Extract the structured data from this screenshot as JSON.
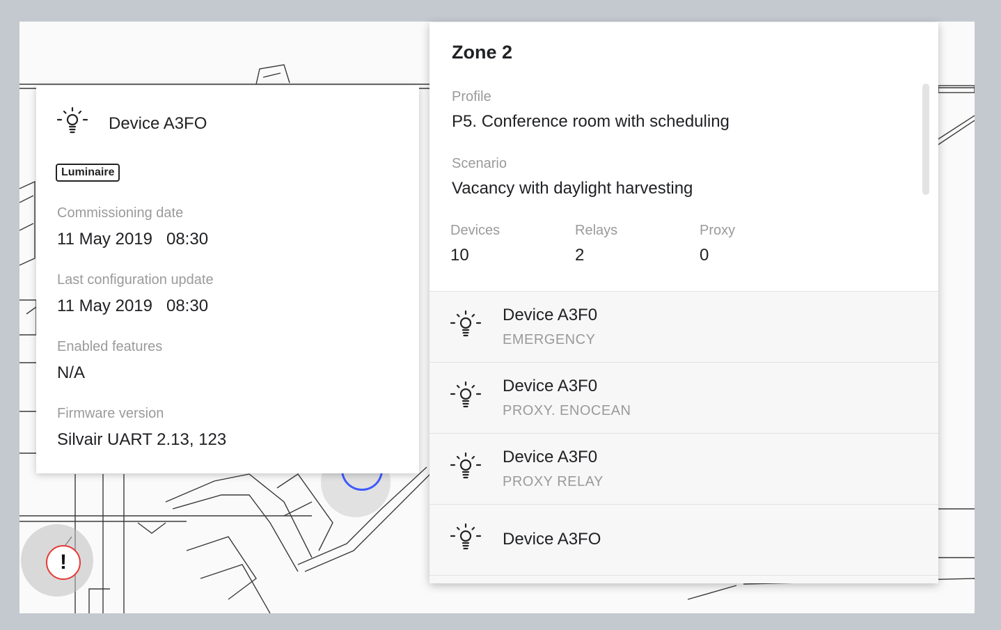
{
  "device_card": {
    "title": "Device A3FO",
    "icon": "lightbulb-icon",
    "tag": "Luminaire",
    "commissioning_label": "Commissioning date",
    "commissioning_date": "11 May 2019",
    "commissioning_time": "08:30",
    "last_update_label": "Last configuration update",
    "last_update_date": "11 May 2019",
    "last_update_time": "08:30",
    "features_label": "Enabled features",
    "features_value": "N/A",
    "firmware_label": "Firmware version",
    "firmware_value": "Silvair UART 2.13, 123"
  },
  "zone": {
    "title": "Zone 2",
    "profile_label": "Profile",
    "profile_value": "P5. Conference room with scheduling",
    "scenario_label": "Scenario",
    "scenario_value": "Vacancy with daylight harvesting",
    "stats": [
      {
        "label": "Devices",
        "value": "10"
      },
      {
        "label": "Relays",
        "value": "2"
      },
      {
        "label": "Proxy",
        "value": "0"
      }
    ],
    "devices": [
      {
        "name": "Device A3F0",
        "sub": "EMERGENCY",
        "icon": "lightbulb-icon"
      },
      {
        "name": "Device A3F0",
        "sub": "PROXY. ENOCEAN",
        "icon": "lightbulb-icon"
      },
      {
        "name": "Device A3F0",
        "sub": "PROXY  RELAY",
        "icon": "lightbulb-icon"
      },
      {
        "name": "Device A3FO",
        "sub": "",
        "icon": "lightbulb-icon"
      }
    ]
  },
  "map": {
    "alert_symbol": "!",
    "alert_color": "#e53935",
    "marker_color": "#3d5afe"
  }
}
